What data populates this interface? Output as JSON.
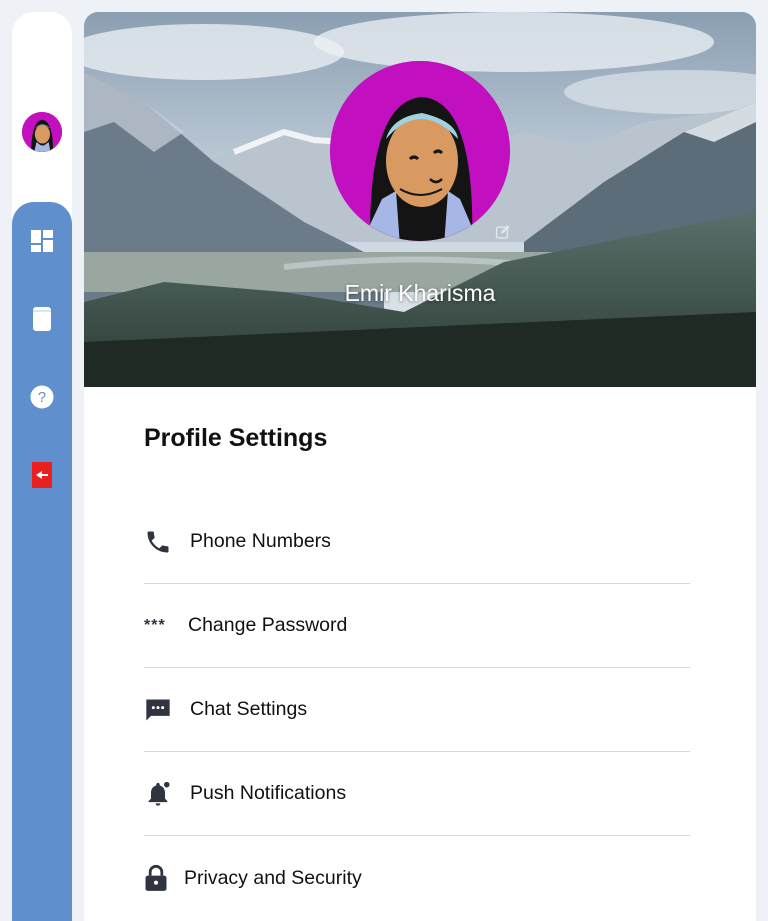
{
  "sidebar": {
    "items": [
      {
        "name": "dashboard",
        "icon": "dashboard-icon"
      },
      {
        "name": "book",
        "icon": "book-icon"
      },
      {
        "name": "help",
        "icon": "help-icon"
      },
      {
        "name": "logout",
        "icon": "logout-icon"
      }
    ],
    "avatar_icon": "user-avatar-icon"
  },
  "profile": {
    "name": "Emir Kharisma",
    "edit_icon": "edit-icon",
    "avatar_color": "#c20fbf"
  },
  "settings": {
    "title": "Profile Settings",
    "items": [
      {
        "label": "Phone Numbers",
        "icon": "phone-icon"
      },
      {
        "label": "Change Password",
        "icon": "password-icon",
        "glyph": "***"
      },
      {
        "label": "Chat Settings",
        "icon": "chat-icon"
      },
      {
        "label": "Push Notifications",
        "icon": "bell-icon"
      },
      {
        "label": "Privacy and Security",
        "icon": "lock-icon"
      }
    ]
  },
  "colors": {
    "rail": "#5f8fcc",
    "logout": "#e8201f",
    "text": "#111111"
  }
}
